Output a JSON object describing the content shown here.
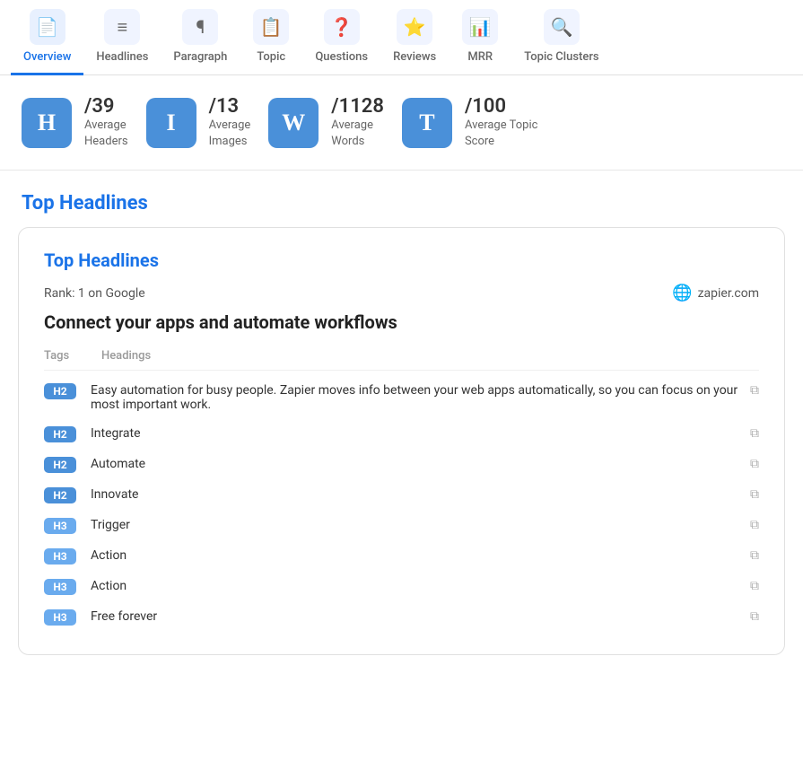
{
  "nav": {
    "tabs": [
      {
        "id": "overview",
        "label": "Overview",
        "icon": "📄",
        "active": true
      },
      {
        "id": "headlines",
        "label": "Headlines",
        "icon": "≡",
        "active": false
      },
      {
        "id": "paragraph",
        "label": "Paragraph",
        "icon": "¶",
        "active": false
      },
      {
        "id": "topic",
        "label": "Topic",
        "icon": "📋",
        "active": false
      },
      {
        "id": "questions",
        "label": "Questions",
        "icon": "❓",
        "active": false
      },
      {
        "id": "reviews",
        "label": "Reviews",
        "icon": "⭐",
        "active": false
      },
      {
        "id": "mrr",
        "label": "MRR",
        "icon": "📊",
        "active": false
      },
      {
        "id": "topic-clusters",
        "label": "Topic Clusters",
        "icon": "🔍",
        "active": false
      }
    ]
  },
  "stats": [
    {
      "icon": "H",
      "value": "/39",
      "label": "Average\nHeaders"
    },
    {
      "icon": "I",
      "value": "/13",
      "label": "Average\nImages"
    },
    {
      "icon": "W",
      "value": "/1128",
      "label": "Average\nWords"
    },
    {
      "icon": "T",
      "value": "/100",
      "label": "Average Topic\nScore"
    }
  ],
  "section_title": "Top Headlines",
  "card": {
    "title": "Top Headlines",
    "rank": "Rank: 1 on Google",
    "domain": "zapier.com",
    "page_title": "Connect your apps and automate workflows",
    "table_headers": {
      "tag": "Tags",
      "heading": "Headings"
    },
    "headings": [
      {
        "tag": "H2",
        "tag_class": "h2",
        "text": "Easy automation for busy people. Zapier moves info between your web apps automatically, so you can focus on your most important work.",
        "multi": true
      },
      {
        "tag": "H2",
        "tag_class": "h2",
        "text": "Integrate",
        "multi": false
      },
      {
        "tag": "H2",
        "tag_class": "h2",
        "text": "Automate",
        "multi": false
      },
      {
        "tag": "H2",
        "tag_class": "h2",
        "text": "Innovate",
        "multi": false
      },
      {
        "tag": "H3",
        "tag_class": "h3",
        "text": "Trigger",
        "multi": false
      },
      {
        "tag": "H3",
        "tag_class": "h3",
        "text": "Action",
        "multi": false
      },
      {
        "tag": "H3",
        "tag_class": "h3",
        "text": "Action",
        "multi": false
      },
      {
        "tag": "H3",
        "tag_class": "h3",
        "text": "Free forever",
        "multi": false
      }
    ]
  }
}
